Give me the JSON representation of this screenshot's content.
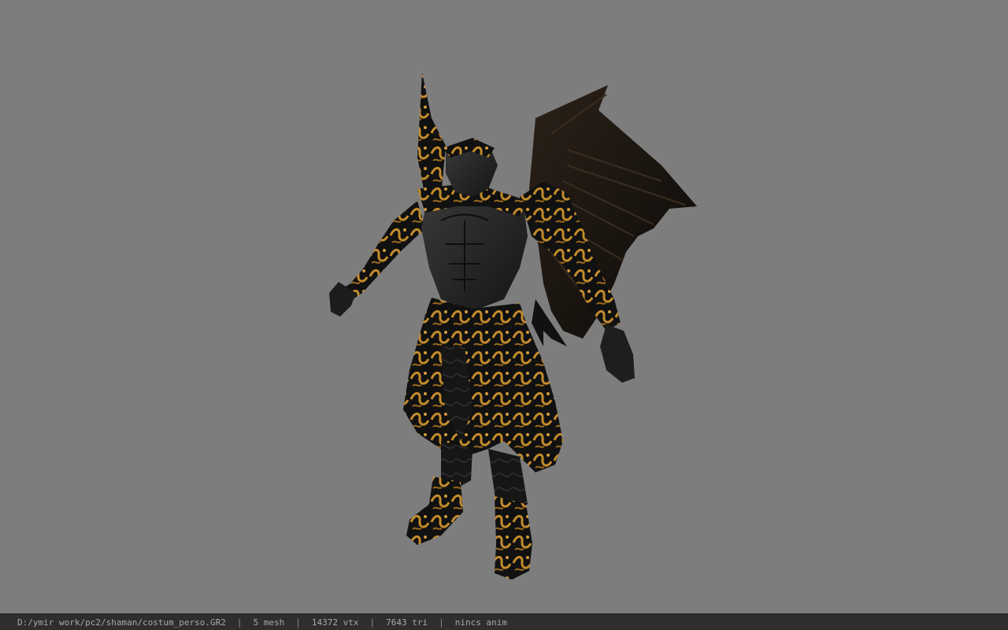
{
  "viewport": {
    "background_color": "#7d7d7d",
    "model_description_icon": "character-model-icon",
    "model_colors": {
      "armor_black": "#141414",
      "skin_dark": "#2a2a2a",
      "gold_pattern": "#c08a2a",
      "wing": "#1a1510"
    }
  },
  "status_bar": {
    "file_path": "D:/ymir work/pc2/shaman/costum_perso.GR2",
    "mesh_count": "5 mesh",
    "vertex_count": "14372 vtx",
    "triangle_count": "7643 tri",
    "animation_status": "nincs anim",
    "separator": "|",
    "background_color": "#2e2e2e",
    "text_color": "#a8a8a8"
  }
}
